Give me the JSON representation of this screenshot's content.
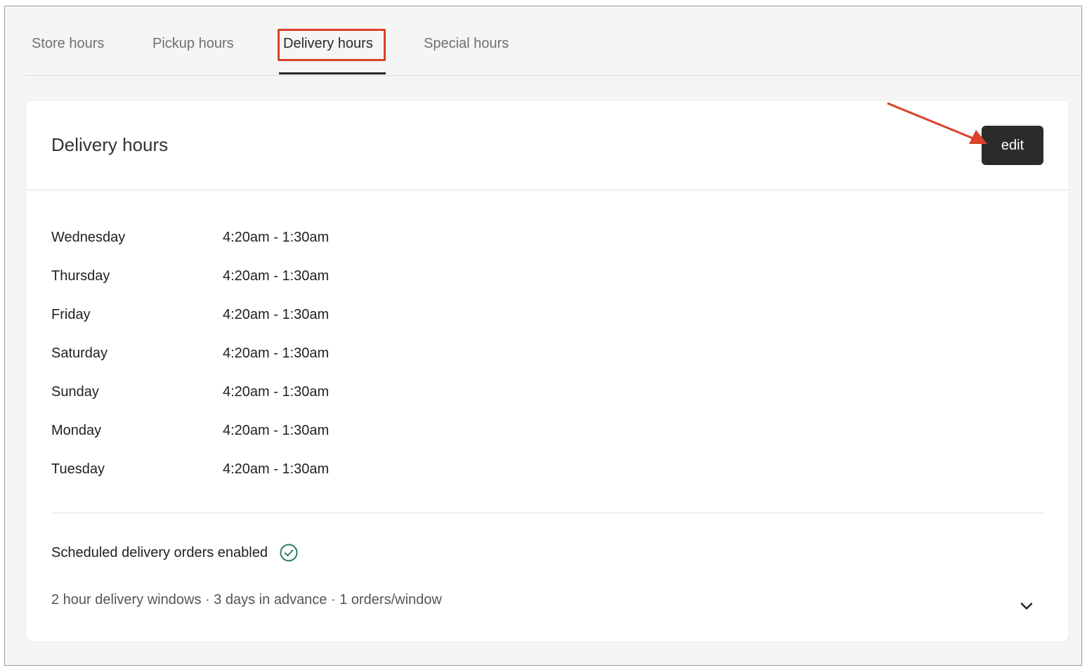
{
  "tabs": [
    {
      "label": "Store hours",
      "active": false
    },
    {
      "label": "Pickup hours",
      "active": false
    },
    {
      "label": "Delivery hours",
      "active": true
    },
    {
      "label": "Special hours",
      "active": false
    }
  ],
  "card": {
    "title": "Delivery hours",
    "edit_label": "edit"
  },
  "hours": [
    {
      "day": "Wednesday",
      "time": "4:20am - 1:30am"
    },
    {
      "day": "Thursday",
      "time": "4:20am - 1:30am"
    },
    {
      "day": "Friday",
      "time": "4:20am - 1:30am"
    },
    {
      "day": "Saturday",
      "time": "4:20am - 1:30am"
    },
    {
      "day": "Sunday",
      "time": "4:20am - 1:30am"
    },
    {
      "day": "Monday",
      "time": "4:20am - 1:30am"
    },
    {
      "day": "Tuesday",
      "time": "4:20am - 1:30am"
    }
  ],
  "scheduled": {
    "label": "Scheduled delivery orders enabled",
    "icon": "check-circle-icon",
    "icon_color": "#2e7d5b"
  },
  "details": {
    "text": "2 hour delivery windows · 3 days in advance · 1 orders/window"
  },
  "annotation": {
    "color": "#d94128"
  }
}
